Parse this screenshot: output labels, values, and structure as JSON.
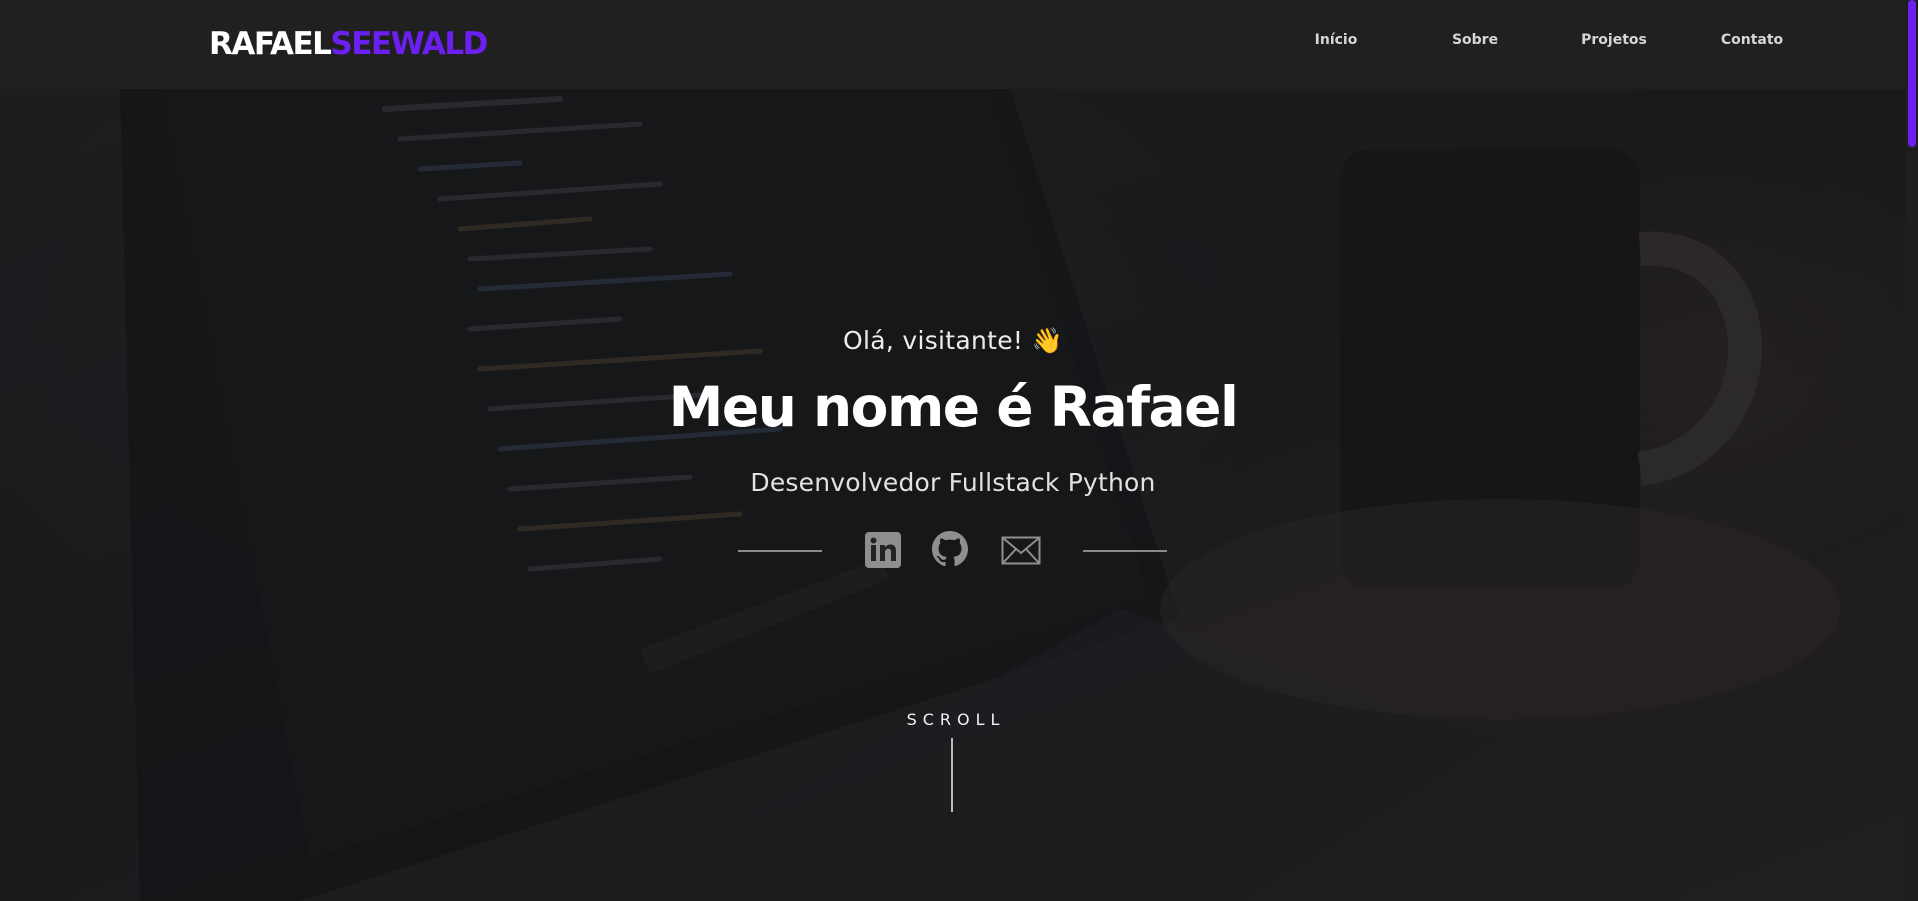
{
  "header": {
    "logo_first": "RAFAEL",
    "logo_last": "SEEWALD",
    "nav": [
      "Início",
      "Sobre",
      "Projetos",
      "Contato"
    ]
  },
  "hero": {
    "greeting": "Olá, visitante!",
    "greeting_emoji": "👋",
    "headline": "Meu nome é Rafael",
    "subtitle": "Desenvolvedor Fullstack Python",
    "social_icons": [
      "linkedin-icon",
      "github-icon",
      "mail-icon"
    ],
    "scroll_label": "SCROLL"
  },
  "colors": {
    "accent": "#6b1ff0",
    "header_bg": "#202021",
    "text": "#ffffff",
    "muted": "#8a8a8a"
  }
}
